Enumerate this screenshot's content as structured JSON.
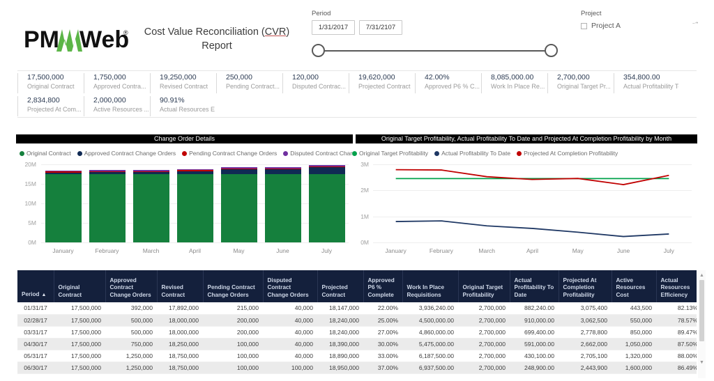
{
  "header": {
    "logo_name": "PMWeb",
    "logo_registered": "®",
    "title_line1_pre": "Cost Value Reconciliation (",
    "title_line1_abbr": "CVR",
    "title_line1_post": ")",
    "title_line2": "Report"
  },
  "period_slicer": {
    "label": "Period",
    "start_date": "1/31/2017",
    "end_date": "7/31/2107",
    "handle_left_name": "slider-handle-left",
    "handle_right_name": "slider-handle-right"
  },
  "project_slicer": {
    "label": "Project",
    "caret_icon": "chevron-icon",
    "options": [
      {
        "label": "Project A",
        "checked": false
      }
    ]
  },
  "kpis": [
    {
      "value": "17,500,000",
      "label": "Original Contract"
    },
    {
      "value": "1,750,000",
      "label": "Approved Contra..."
    },
    {
      "value": "19,250,000",
      "label": "Revised Contract"
    },
    {
      "value": "250,000",
      "label": "Pending Contract..."
    },
    {
      "value": "120,000",
      "label": "Disputed Contrac..."
    },
    {
      "value": "19,620,000",
      "label": "Projected Contract"
    },
    {
      "value": "42.00%",
      "label": "Approved P6 % C..."
    },
    {
      "value": "8,085,000.00",
      "label": "Work In Place Re..."
    },
    {
      "value": "2,700,000",
      "label": "Original Target Pr..."
    },
    {
      "value": "354,800.00",
      "label": "Actual Profitability To..."
    },
    {
      "value": "2,834,800",
      "label": "Projected At Com..."
    },
    {
      "value": "2,000,000",
      "label": "Active Resources ..."
    },
    {
      "value": "90.91%",
      "label": "Actual Resources Effi..."
    }
  ],
  "chart_data": [
    {
      "type": "bar",
      "title": "Change Order Details",
      "stacked": true,
      "categories": [
        "January",
        "February",
        "March",
        "April",
        "May",
        "June",
        "July"
      ],
      "series": [
        {
          "name": "Original Contract",
          "color": "#15803d",
          "values": [
            17500000,
            17500000,
            17500000,
            17500000,
            17500000,
            17500000,
            17500000
          ]
        },
        {
          "name": "Approved Contract Change Orders",
          "color": "#102a54",
          "values": [
            392000,
            500000,
            500000,
            750000,
            1250000,
            1250000,
            1750000
          ]
        },
        {
          "name": "Pending Contract Change Orders",
          "color": "#c00000",
          "values": [
            215000,
            200000,
            200000,
            100000,
            100000,
            100000,
            250000
          ]
        },
        {
          "name": "Disputed Contract Change O...",
          "color": "#7030a0",
          "values": [
            40000,
            40000,
            40000,
            40000,
            40000,
            100000,
            120000
          ]
        }
      ],
      "xlabel": "",
      "ylabel": "",
      "ylim": [
        0,
        20000000
      ],
      "yticks": [
        "0M",
        "5M",
        "10M",
        "15M",
        "20M"
      ],
      "grid": true,
      "legend_position": "top"
    },
    {
      "type": "line",
      "title": "Original Target Profitability, Actual Profitability To Date and Projected At Completion Profitability by Month",
      "categories": [
        "January",
        "February",
        "March",
        "April",
        "May",
        "June",
        "July"
      ],
      "series": [
        {
          "name": "Original Target Profitability",
          "color": "#00a14b",
          "values": [
            2700000,
            2700000,
            2700000,
            2700000,
            2700000,
            2700000,
            2700000
          ]
        },
        {
          "name": "Actual Profitability To Date",
          "color": "#1f3864",
          "values": [
            882240,
            910000,
            699400,
            591000,
            430100,
            248900,
            354800
          ]
        },
        {
          "name": "Projected At Completion Profitability",
          "color": "#c00000",
          "values": [
            3075400,
            3062500,
            2778800,
            2662000,
            2705100,
            2443900,
            2834800
          ]
        }
      ],
      "xlabel": "",
      "ylabel": "",
      "ylim": [
        0,
        3300000
      ],
      "yticks": [
        "0M",
        "1M",
        "2M",
        "3M"
      ],
      "grid": true,
      "legend_position": "top"
    }
  ],
  "table": {
    "sort_column": "Period",
    "sort_icon": "sort-asc-icon",
    "columns": [
      "Period",
      "Original Contract",
      "Approved Contract Change Orders",
      "Revised Contract",
      "Pending Contract Change Orders",
      "Disputed Contract Change Orders",
      "Projected Contract",
      "Approved P6 % Complete",
      "Work In Place Requisitions",
      "Original Target Profitability",
      "Actual Profitability To Date",
      "Projected At Completion Profitability",
      "Active Resources Cost",
      "Actual Resources Efficiency"
    ],
    "rows": [
      [
        "01/31/17",
        "17,500,000",
        "392,000",
        "17,892,000",
        "215,000",
        "40,000",
        "18,147,000",
        "22.00%",
        "3,936,240.00",
        "2,700,000",
        "882,240.00",
        "3,075,400",
        "443,500",
        "82.13%"
      ],
      [
        "02/28/17",
        "17,500,000",
        "500,000",
        "18,000,000",
        "200,000",
        "40,000",
        "18,240,000",
        "25.00%",
        "4,500,000.00",
        "2,700,000",
        "910,000.00",
        "3,062,500",
        "550,000",
        "78.57%"
      ],
      [
        "03/31/17",
        "17,500,000",
        "500,000",
        "18,000,000",
        "200,000",
        "40,000",
        "18,240,000",
        "27.00%",
        "4,860,000.00",
        "2,700,000",
        "699,400.00",
        "2,778,800",
        "850,000",
        "89.47%"
      ],
      [
        "04/30/17",
        "17,500,000",
        "750,000",
        "18,250,000",
        "100,000",
        "40,000",
        "18,390,000",
        "30.00%",
        "5,475,000.00",
        "2,700,000",
        "591,000.00",
        "2,662,000",
        "1,050,000",
        "87.50%"
      ],
      [
        "05/31/17",
        "17,500,000",
        "1,250,000",
        "18,750,000",
        "100,000",
        "40,000",
        "18,890,000",
        "33.00%",
        "6,187,500.00",
        "2,700,000",
        "430,100.00",
        "2,705,100",
        "1,320,000",
        "88.00%"
      ],
      [
        "06/30/17",
        "17,500,000",
        "1,250,000",
        "18,750,000",
        "100,000",
        "100,000",
        "18,950,000",
        "37.00%",
        "6,937,500.00",
        "2,700,000",
        "248,900.00",
        "2,443,900",
        "1,600,000",
        "86.49%"
      ]
    ],
    "scrollbar": {
      "up_icon": "caret-up-icon",
      "down_icon": "caret-down-icon"
    }
  }
}
